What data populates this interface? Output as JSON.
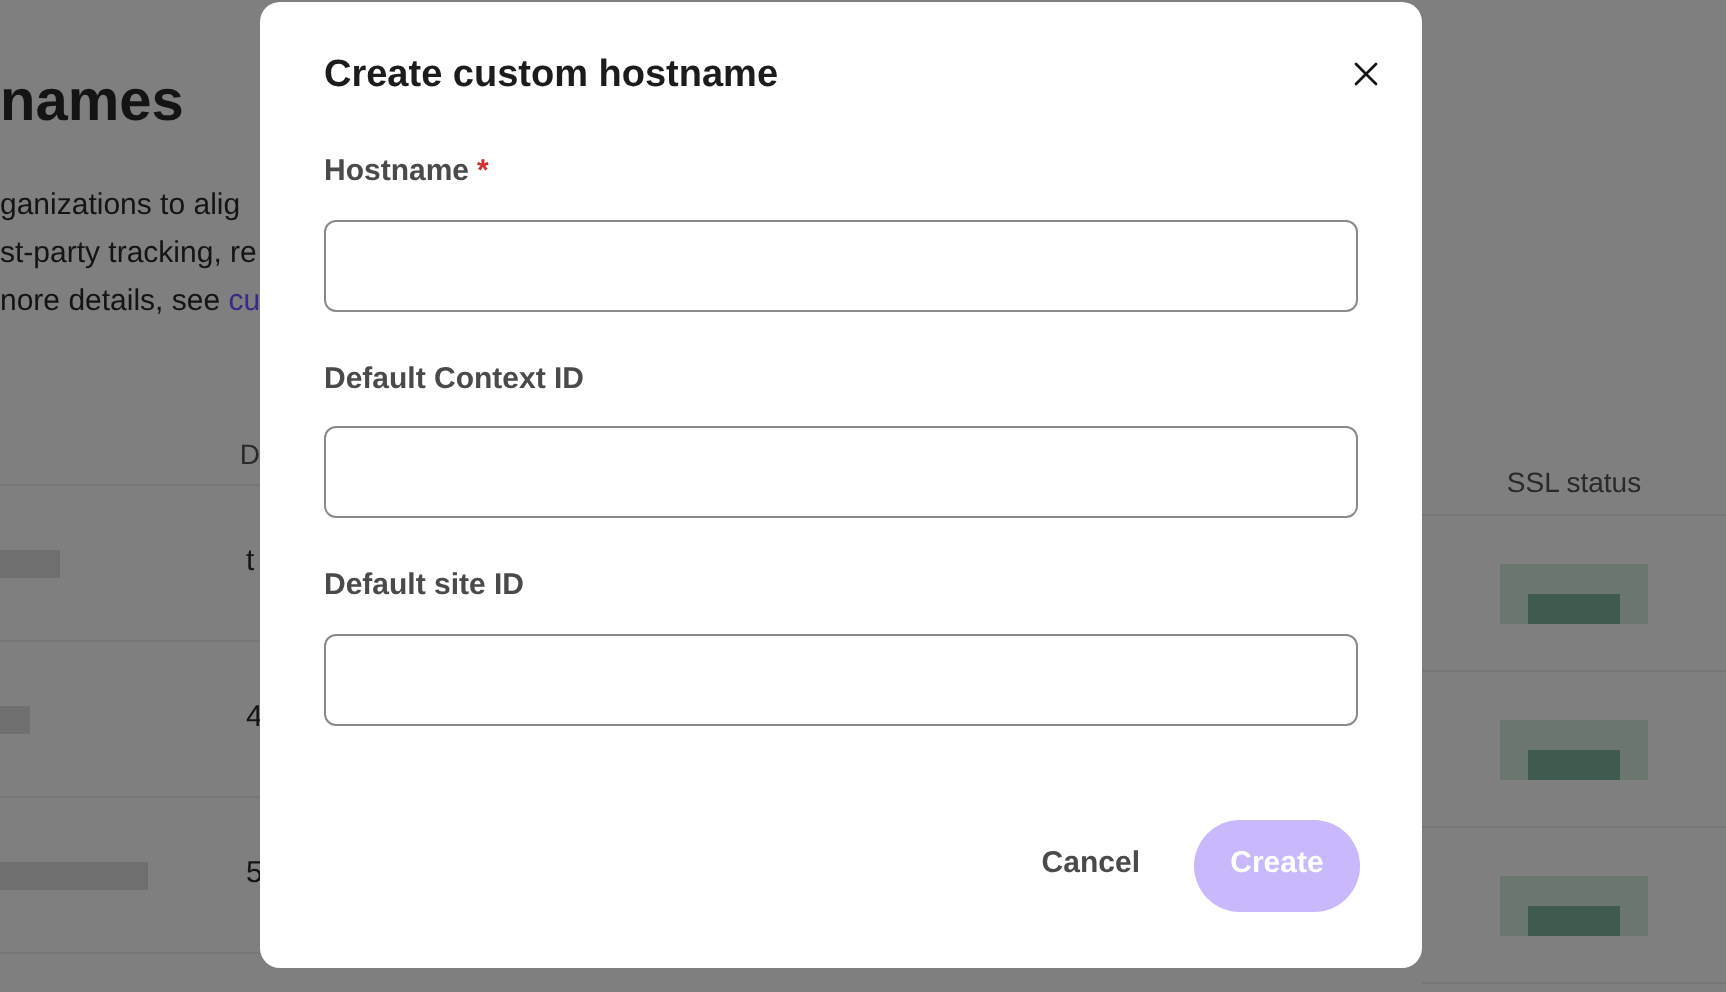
{
  "page": {
    "title": "names",
    "description": [
      "ganizations to alig",
      "st-party tracking, re"
    ],
    "description_last": "nore details, see ",
    "description_link": "cu"
  },
  "table": {
    "columns": [
      "D",
      "SSL status"
    ],
    "rows": [
      {
        "cell": "t"
      },
      {
        "cell": "4"
      },
      {
        "cell": "5"
      }
    ]
  },
  "dialog": {
    "title": "Create custom hostname",
    "fields": [
      {
        "label": "Hostname",
        "required": true
      },
      {
        "label": "Default Context ID",
        "required": false
      },
      {
        "label": "Default site ID",
        "required": false
      }
    ],
    "required_mark": "*",
    "cancel": "Cancel",
    "create": "Create",
    "create_disabled": true
  }
}
